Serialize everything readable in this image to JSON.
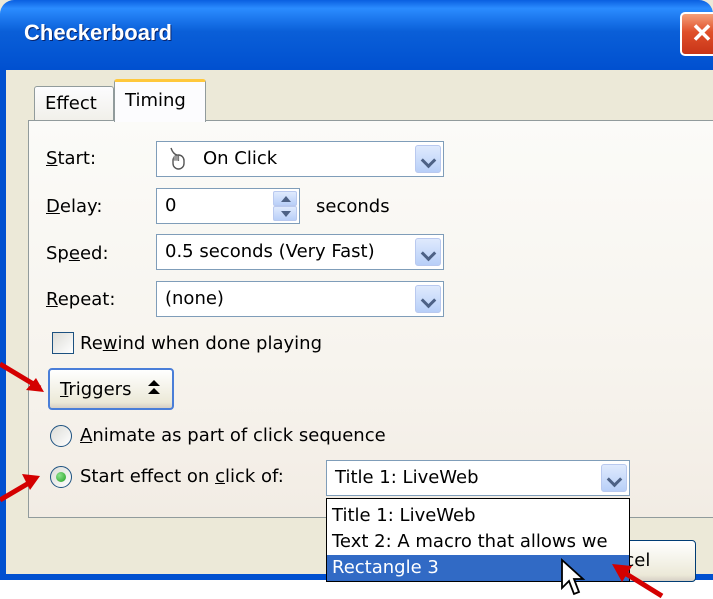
{
  "window": {
    "title": "Checkerboard",
    "close_label": "✕"
  },
  "tabs": [
    {
      "label": "Effect"
    },
    {
      "label": "Timing"
    }
  ],
  "timing": {
    "start": {
      "label_pre": "",
      "label_ul": "S",
      "label_post": "tart:",
      "value": "On Click",
      "icon": "mouse-icon"
    },
    "delay": {
      "label_ul": "D",
      "label_post": "elay:",
      "value": "0",
      "unit": "seconds"
    },
    "speed": {
      "label_pre": "Sp",
      "label_ul": "e",
      "label_post": "ed:",
      "value": "0.5 seconds (Very Fast)"
    },
    "repeat": {
      "label_ul": "R",
      "label_post": "epeat:",
      "value": "(none)"
    },
    "rewind": {
      "label_pre": "Re",
      "label_ul": "w",
      "label_post": "ind when done playing",
      "checked": false
    }
  },
  "triggers": {
    "button_ul": "T",
    "button_post": "riggers",
    "button_icon": "double-up-arrow-icon",
    "animate": {
      "label_ul": "A",
      "label_post": "nimate as part of click sequence",
      "checked": false
    },
    "start_on_click": {
      "label_pre": "Start effect on ",
      "label_ul": "c",
      "label_post": "lick of:",
      "checked": true
    },
    "selected_value": "Title 1: LiveWeb",
    "options": [
      "Title 1: LiveWeb",
      "Text 2: A macro that allows we",
      "Rectangle 3"
    ],
    "highlighted_option": "Rectangle 3"
  },
  "cancel_label": "ncel",
  "colors": {
    "titlebar": "#0a5fd8",
    "highlight": "#316ac5",
    "arrow": "#d40000",
    "tab_accent": "#ffc83c"
  }
}
